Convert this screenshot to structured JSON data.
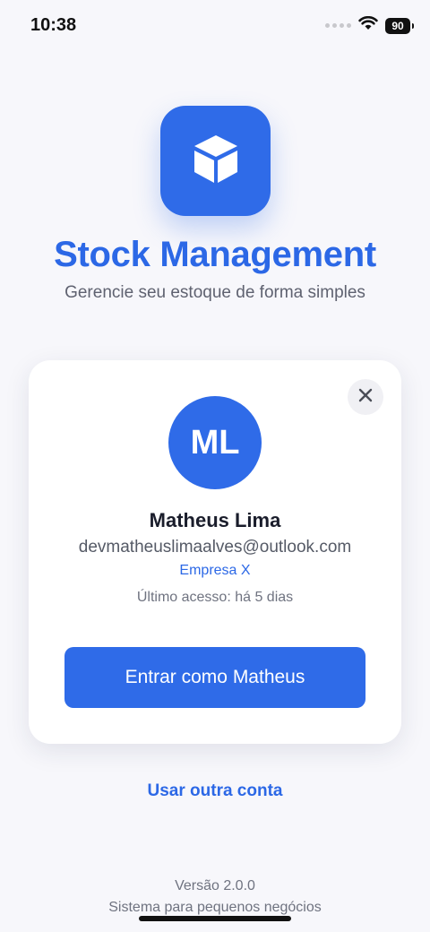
{
  "status_bar": {
    "time": "10:38",
    "battery": "90",
    "icons": [
      "signal-dots-icon",
      "wifi-icon",
      "battery-icon"
    ]
  },
  "app": {
    "title": "Stock Management",
    "subtitle": "Gerencie seu estoque de forma simples",
    "logo_icon": "cube-icon"
  },
  "account": {
    "initials": "ML",
    "name": "Matheus Lima",
    "email": "devmatheuslimaalves@outlook.com",
    "company": "Empresa X",
    "last_access": "Último acesso: há 5 dias",
    "login_button": "Entrar como Matheus",
    "close_icon": "close-icon"
  },
  "actions": {
    "other_account": "Usar outra conta"
  },
  "footer": {
    "version": "Versão 2.0.0",
    "tagline": "Sistema para pequenos negócios"
  },
  "colors": {
    "accent": "#2f6be8",
    "background": "#f7f7fb"
  }
}
